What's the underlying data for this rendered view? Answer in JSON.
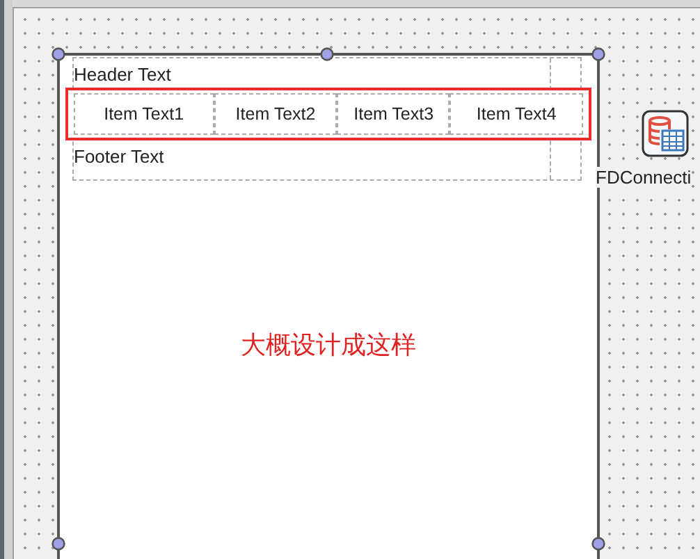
{
  "form": {
    "header": "Header Text",
    "items": [
      "Item Text1",
      "Item Text2",
      "Item Text3",
      "Item Text4"
    ],
    "items_highlighted": true,
    "footer": "Footer Text",
    "caption": "大概设计成这样"
  },
  "component": {
    "label": "FDConnecti"
  }
}
